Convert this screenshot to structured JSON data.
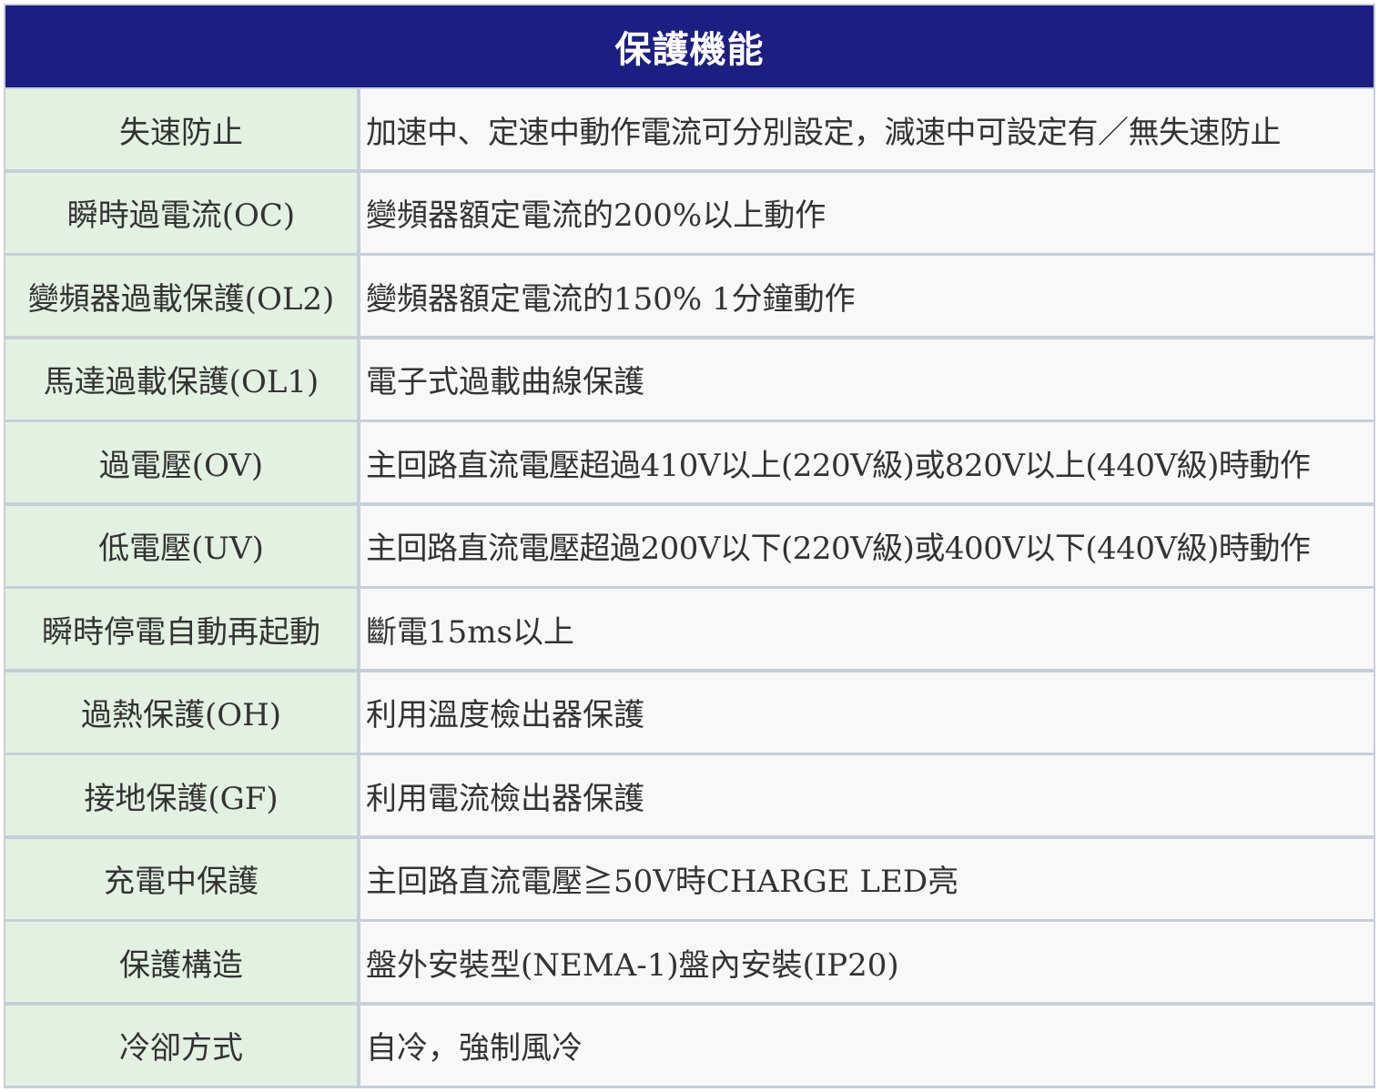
{
  "title": "保護機能",
  "rows": [
    {
      "label": "失速防止",
      "value": "加速中、定速中動作電流可分別設定，減速中可設定有／無失速防止"
    },
    {
      "label": "瞬時過電流(OC)",
      "value": "變頻器額定電流的200%以上動作"
    },
    {
      "label": "變頻器過載保護(OL2)",
      "value": "變頻器額定電流的150% 1分鐘動作"
    },
    {
      "label": "馬達過載保護(OL1)",
      "value": "電子式過載曲線保護"
    },
    {
      "label": "過電壓(OV)",
      "value": "主回路直流電壓超過410V以上(220V級)或820V以上(440V級)時動作"
    },
    {
      "label": "低電壓(UV)",
      "value": "主回路直流電壓超過200V以下(220V級)或400V以下(440V級)時動作"
    },
    {
      "label": "瞬時停電自動再起動",
      "value": "斷電15ms以上"
    },
    {
      "label": "過熱保護(OH)",
      "value": "利用溫度檢出器保護"
    },
    {
      "label": "接地保護(GF)",
      "value": "利用電流檢出器保護"
    },
    {
      "label": "充電中保護",
      "value": "主回路直流電壓≧50V時CHARGE LED亮"
    },
    {
      "label": "保護構造",
      "value": "盤外安裝型(NEMA-1)盤內安裝(IP20)"
    },
    {
      "label": "冷卻方式",
      "value": "自冷，強制風冷"
    }
  ]
}
